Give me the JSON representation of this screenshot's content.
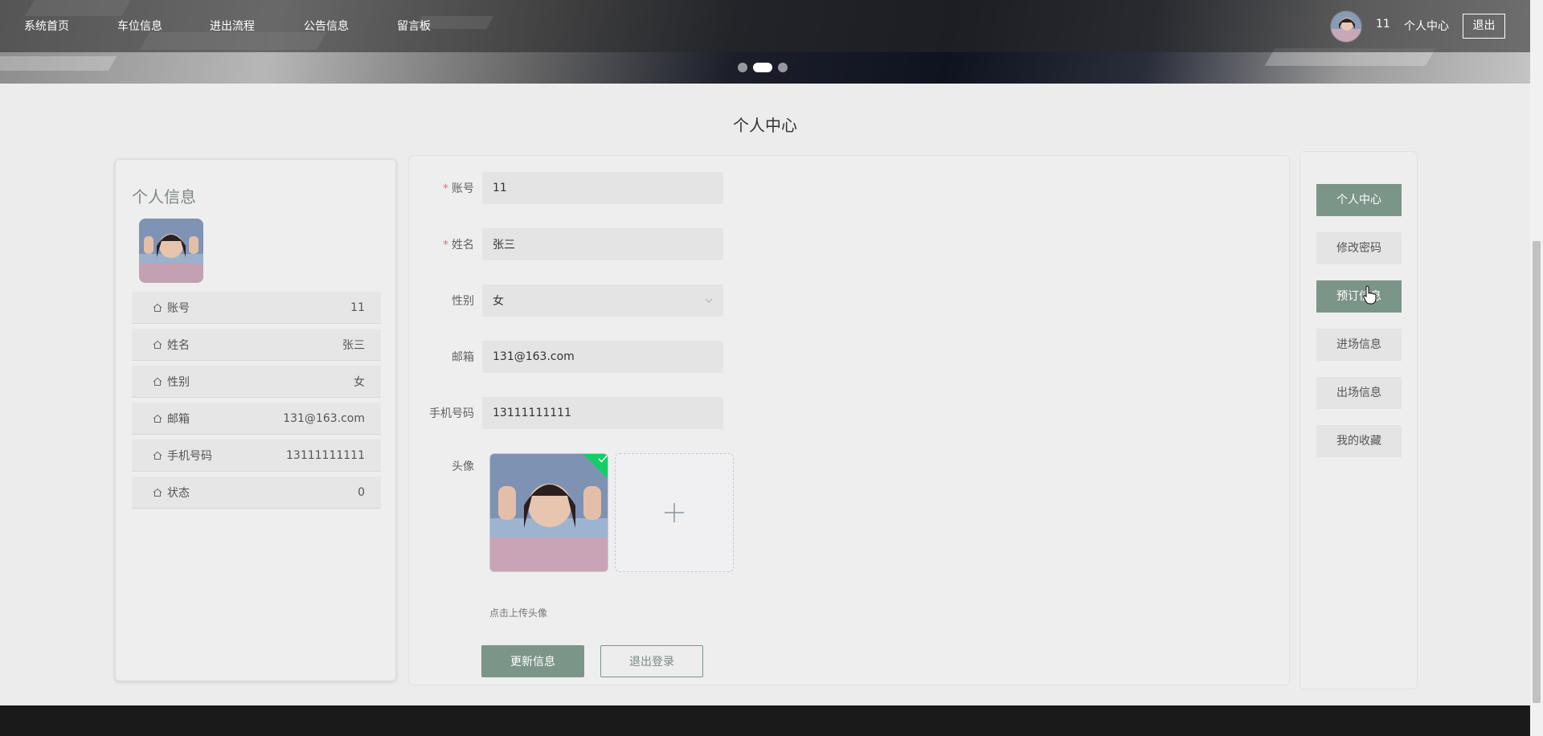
{
  "nav": {
    "items": [
      "系统首页",
      "车位信息",
      "进出流程",
      "公告信息",
      "留言板"
    ],
    "username": "11",
    "center_label": "个人中心",
    "logout_label": "退出"
  },
  "carousel": {
    "count": 3,
    "active_index": 1
  },
  "page": {
    "title": "个人中心"
  },
  "profile": {
    "title": "个人信息",
    "rows": [
      {
        "label": "账号",
        "value": "11"
      },
      {
        "label": "姓名",
        "value": "张三"
      },
      {
        "label": "性别",
        "value": "女"
      },
      {
        "label": "邮箱",
        "value": "131@163.com"
      },
      {
        "label": "手机号码",
        "value": "13111111111"
      },
      {
        "label": "状态",
        "value": "0"
      }
    ]
  },
  "form": {
    "account_label": "账号",
    "account_value": "11",
    "name_label": "姓名",
    "name_value": "张三",
    "gender_label": "性别",
    "gender_value": "女",
    "email_label": "邮箱",
    "email_value": "131@163.com",
    "phone_label": "手机号码",
    "phone_value": "13111111111",
    "avatar_label": "头像",
    "upload_tip": "点击上传头像",
    "update_button": "更新信息",
    "logout_button": "退出登录"
  },
  "menu": {
    "items": [
      "个人中心",
      "修改密码",
      "预订信息",
      "进场信息",
      "出场信息",
      "我的收藏"
    ],
    "active": [
      0,
      2
    ]
  },
  "colors": {
    "accent": "#7c9589",
    "required": "#f56c6c",
    "success": "#13ce66"
  }
}
